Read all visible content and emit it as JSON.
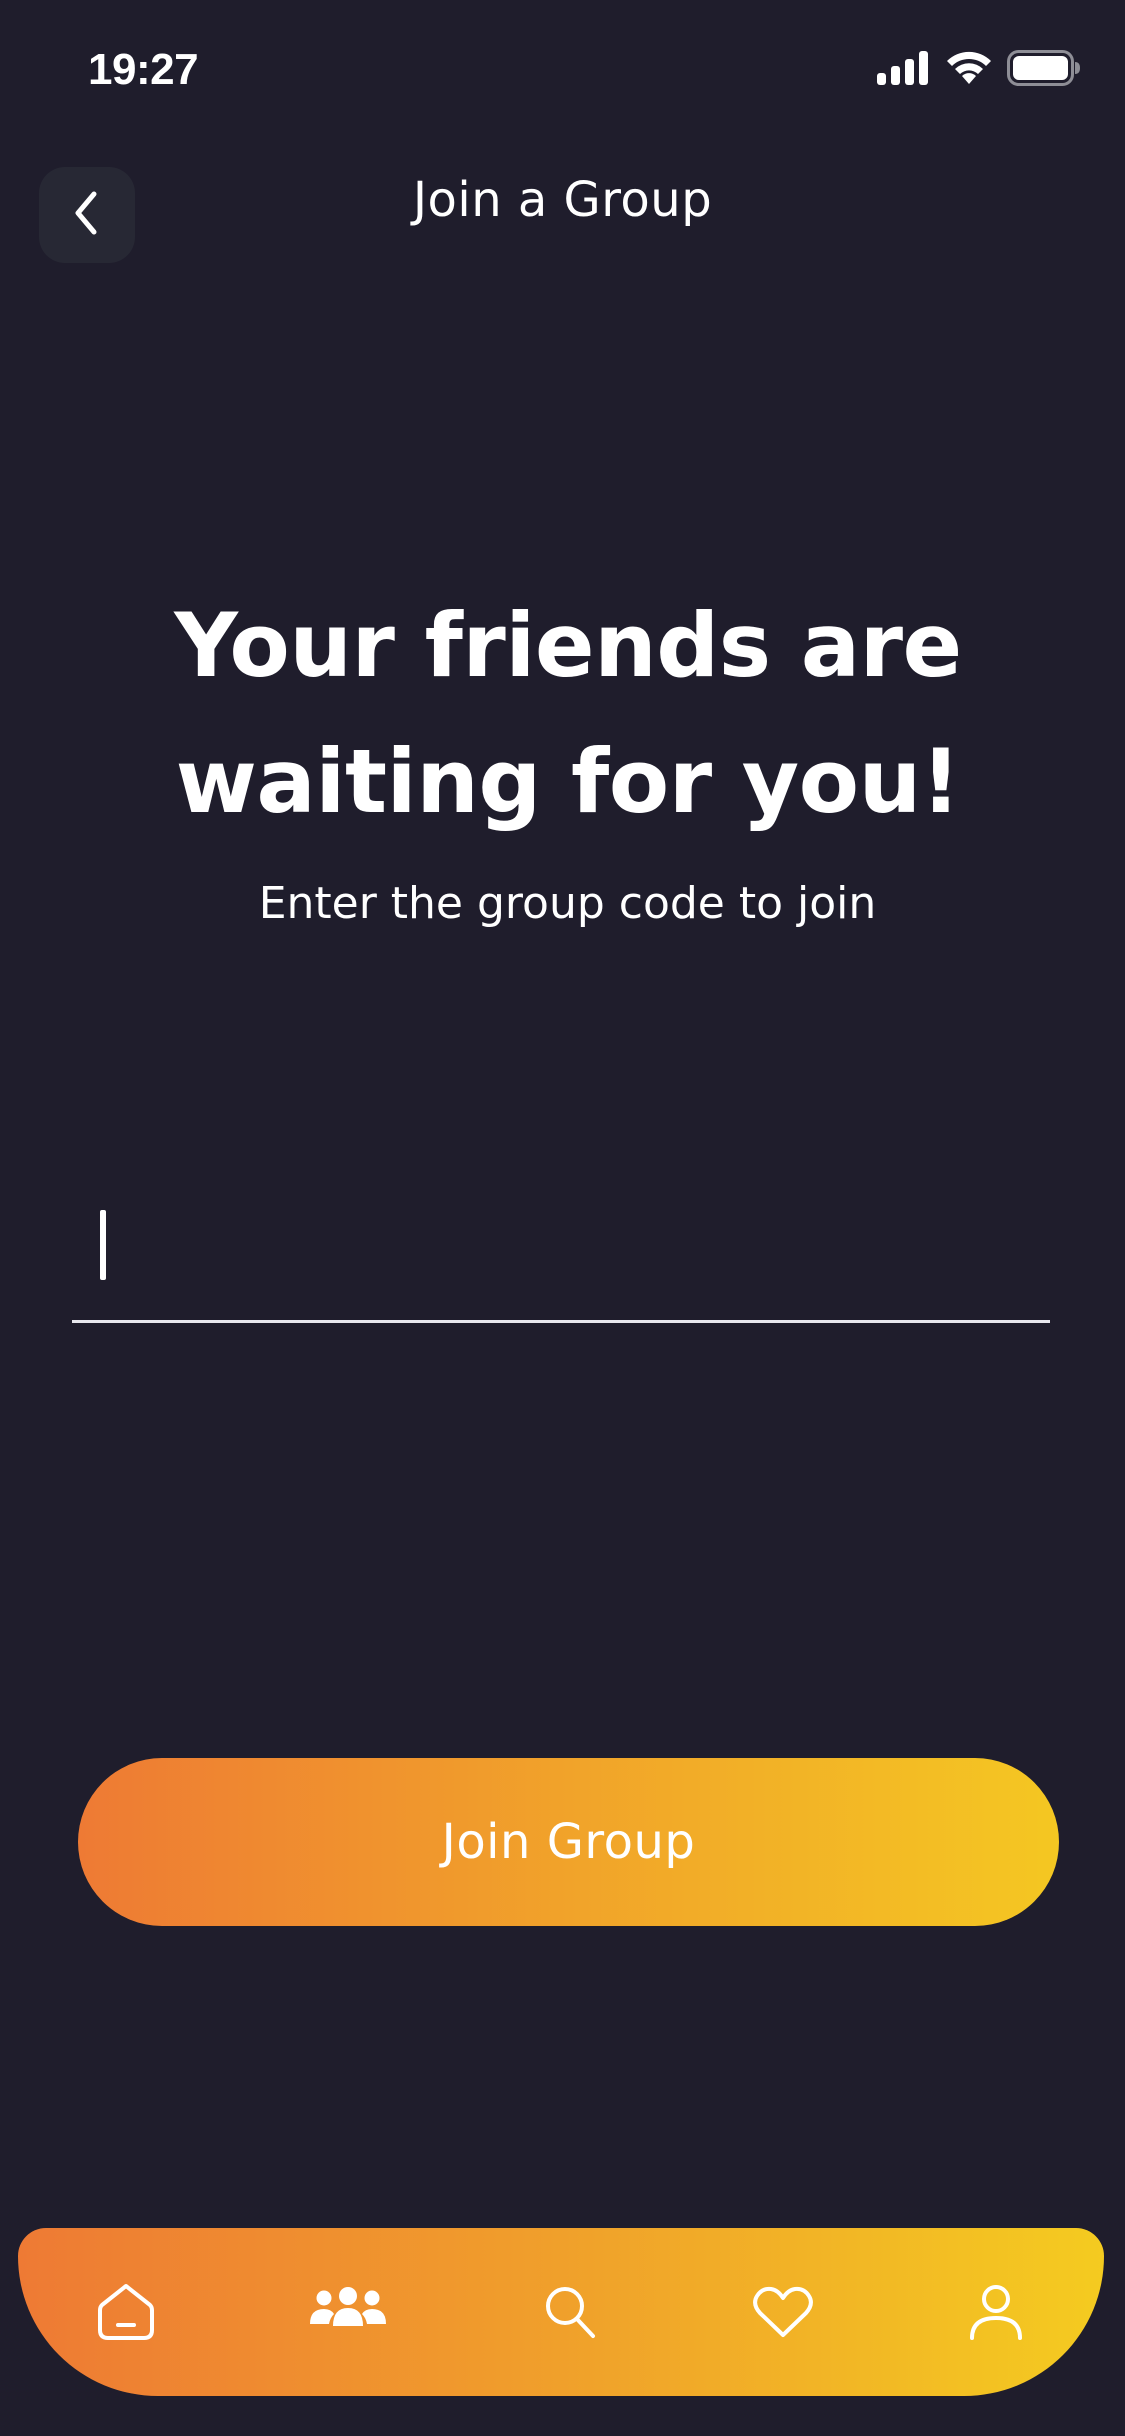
{
  "status_bar": {
    "time": "19:27",
    "icons": [
      "signal-icon",
      "wifi-icon",
      "battery-icon"
    ]
  },
  "header": {
    "back_icon": "chevron-left-icon",
    "title": "Join a Group"
  },
  "main": {
    "headline": "Your friends are waiting for you!",
    "subheadline": "Enter the group code to join",
    "code_input": {
      "value": "",
      "placeholder": ""
    },
    "join_button_label": "Join Group"
  },
  "bottom_nav": {
    "items": [
      {
        "icon": "home-icon"
      },
      {
        "icon": "group-icon",
        "active": true
      },
      {
        "icon": "search-icon"
      },
      {
        "icon": "heart-icon"
      },
      {
        "icon": "profile-icon"
      }
    ]
  },
  "colors": {
    "background": "#1f1d2c",
    "back_button_bg": "#272834",
    "gradient_start": "#ee7a34",
    "gradient_end": "#f4c722",
    "text": "#ffffff"
  }
}
